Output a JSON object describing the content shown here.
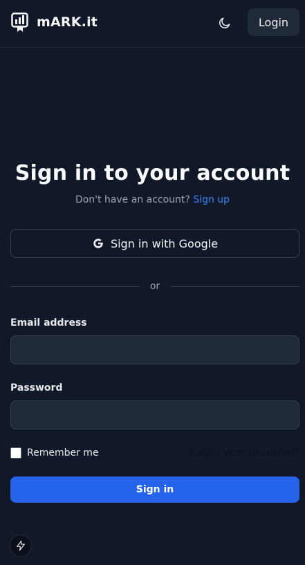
{
  "header": {
    "app_name": "mARK.it",
    "login_label": "Login"
  },
  "main": {
    "title": "Sign in to your account",
    "subtitle_prefix": "Don't have an account?",
    "signup_link": "Sign up",
    "google_label": "Sign in with Google",
    "divider_text": "or",
    "email_label": "Email address",
    "email_value": "",
    "password_label": "Password",
    "password_value": "",
    "remember_label": "Remember me",
    "forgot_label": "Forgot your password?",
    "signin_label": "Sign in"
  },
  "icons": {
    "logo": "logo-icon",
    "theme": "moon-icon",
    "google": "google-icon",
    "bolt": "bolt-icon"
  },
  "colors": {
    "background": "#111827",
    "surface": "#1f2937",
    "accent": "#2563eb",
    "link": "#3b82f6"
  }
}
